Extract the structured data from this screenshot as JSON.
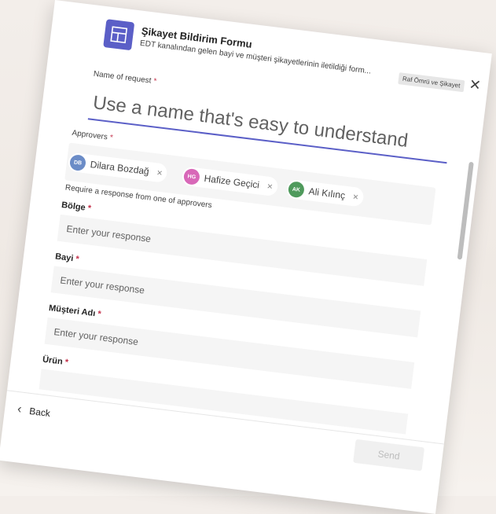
{
  "form": {
    "title": "Şikayet Bildirim Formu",
    "subtitle": "EDT kanalından gelen bayi ve müşteri şikayetlerinin iletildiği form...",
    "tag": "Raf Ömrü ve Şikayet",
    "close_icon": "close-icon",
    "app_icon": "form-app-icon"
  },
  "name_of_request": {
    "label": "Name of request",
    "required_mark": "*",
    "placeholder": "Use a name that's easy to understand"
  },
  "approvers": {
    "label": "Approvers",
    "required_mark": "*",
    "chips": [
      {
        "initials": "DB",
        "name": "Dilara Bozdağ",
        "color": "#6b8cc7"
      },
      {
        "initials": "HG",
        "name": "Hafize Geçici",
        "color": "#d868b8"
      },
      {
        "initials": "AK",
        "name": "Ali Kılınç",
        "color": "#4f9a5c"
      }
    ],
    "remove_symbol": "×",
    "note": "Require a response from one of approvers"
  },
  "fields": [
    {
      "label": "Bölge",
      "required_mark": "*",
      "placeholder": "Enter your response"
    },
    {
      "label": "Bayi",
      "required_mark": "*",
      "placeholder": "Enter your response"
    },
    {
      "label": "Müşteri Adı",
      "required_mark": "*",
      "placeholder": "Enter your response"
    },
    {
      "label": "Ürün",
      "required_mark": "*",
      "placeholder": ""
    }
  ],
  "footer": {
    "back_label": "Back",
    "send_label": "Send"
  },
  "colors": {
    "accent": "#5b5fc7",
    "required": "#c4314b"
  }
}
